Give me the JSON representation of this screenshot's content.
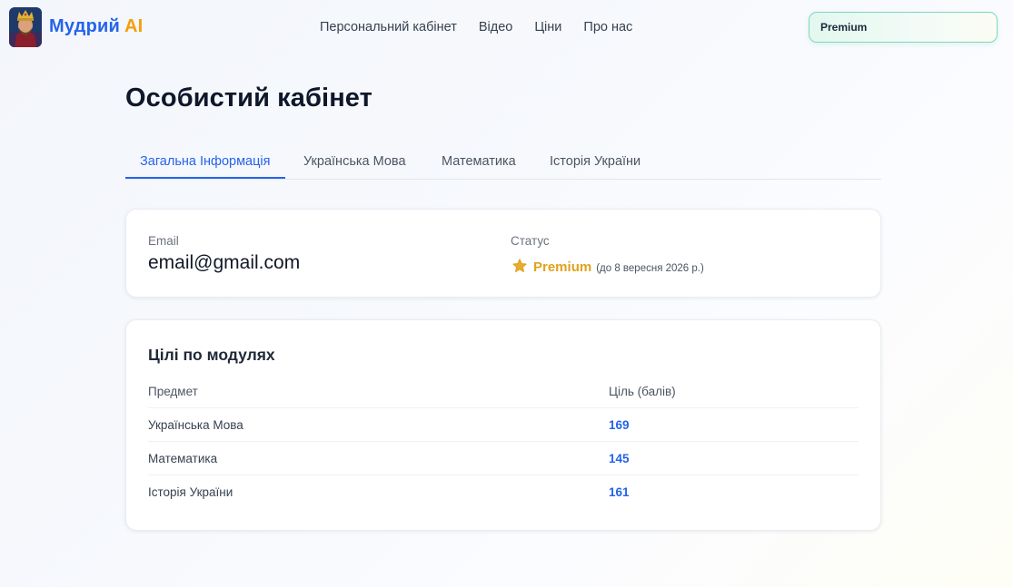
{
  "header": {
    "brand_part1": "Мудрий",
    "brand_part2": "AI",
    "nav": [
      "Персональний кабінет",
      "Відео",
      "Ціни",
      "Про нас"
    ],
    "premium_button": "Premium"
  },
  "page": {
    "title": "Особистий кабінет"
  },
  "tabs": [
    {
      "label": "Загальна Інформація",
      "active": true
    },
    {
      "label": "Українська Мова",
      "active": false
    },
    {
      "label": "Математика",
      "active": false
    },
    {
      "label": "Історія України",
      "active": false
    }
  ],
  "account": {
    "email_label": "Email",
    "email_value": "email@gmail.com",
    "status_label": "Статус",
    "status_value": "Premium",
    "status_until": "(до 8 вересня 2026 р.)",
    "status_icon": "star-icon"
  },
  "goals": {
    "title": "Цілі по модулях",
    "columns": [
      "Предмет",
      "Ціль (балів)"
    ],
    "rows": [
      {
        "subject": "Українська Мова",
        "goal": "169"
      },
      {
        "subject": "Математика",
        "goal": "145"
      },
      {
        "subject": "Історія України",
        "goal": "161"
      }
    ]
  },
  "colors": {
    "accent": "#2563eb",
    "brand_ai": "#f59e0b",
    "premium": "#e0a21c",
    "premium_border": "#7fd8bd"
  }
}
